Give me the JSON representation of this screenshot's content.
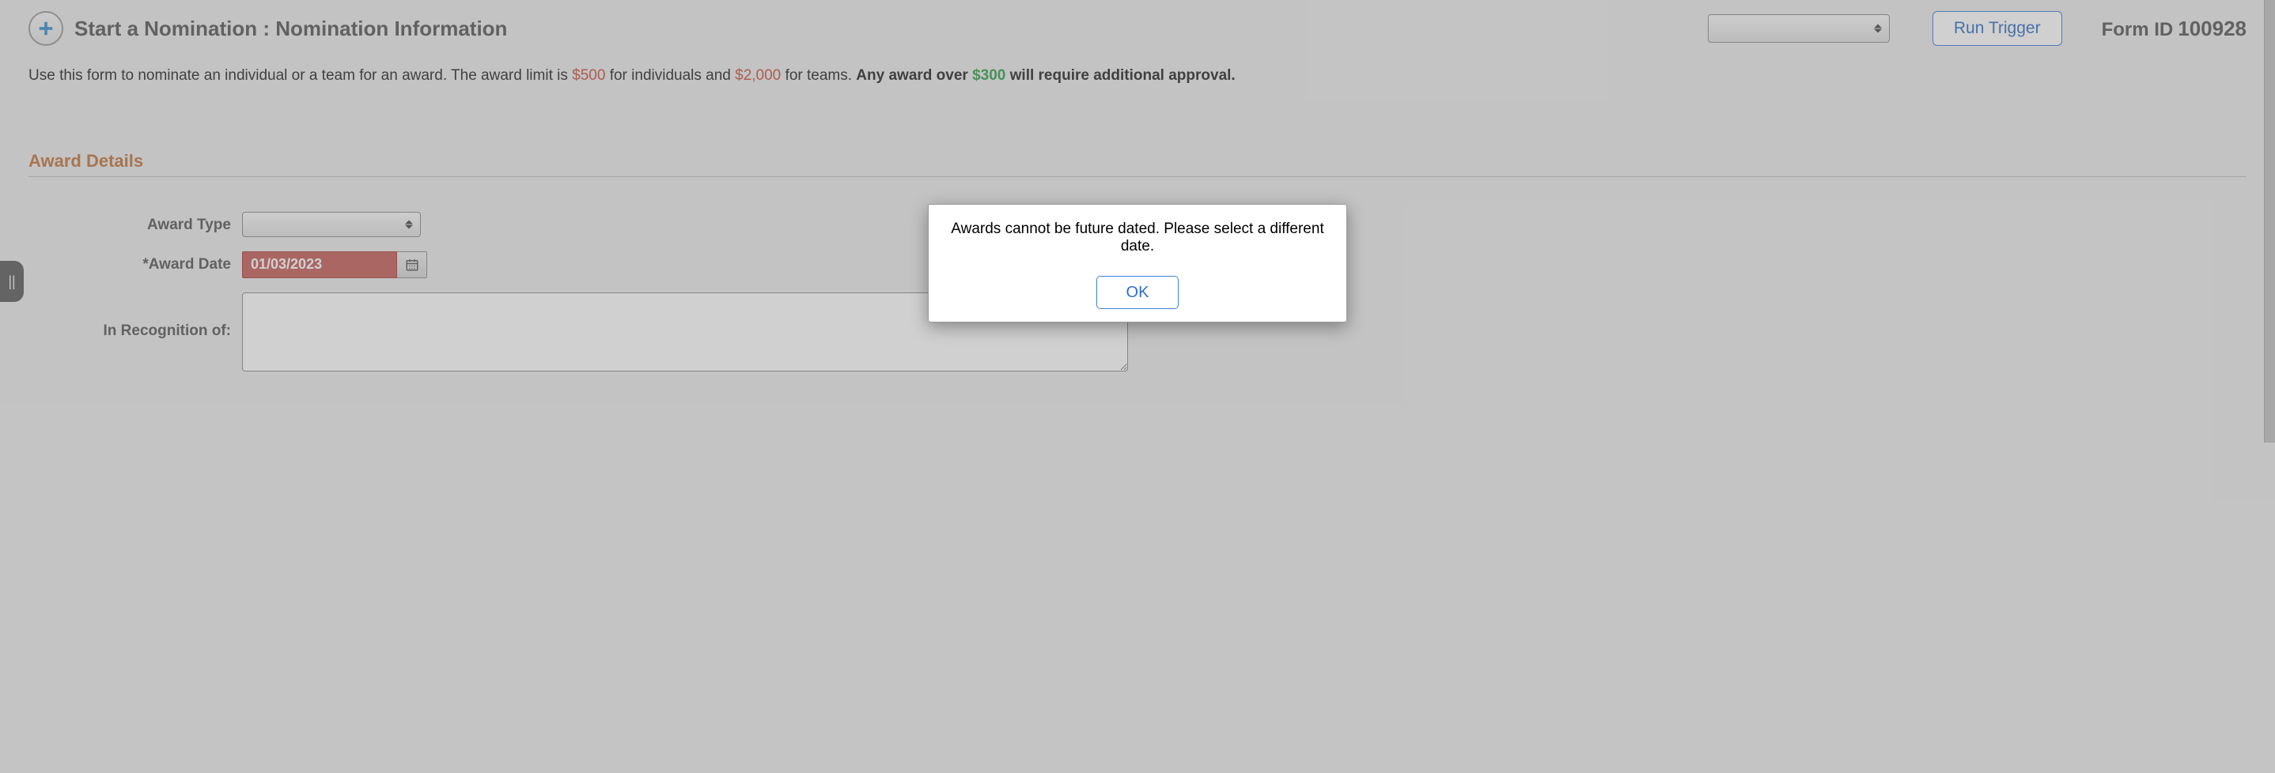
{
  "header": {
    "title": "Start a Nomination :  Nomination Information",
    "run_trigger_label": "Run Trigger",
    "form_id_label": "Form ID",
    "form_id_value": "100928",
    "dropdown_value": ""
  },
  "intro": {
    "prefix": "Use this form to nominate an individual or a team for an award. The award limit is ",
    "amount_individual": "$500",
    "mid1": " for individuals and ",
    "amount_team": "$2,000",
    "mid2": " for teams. ",
    "bold_prefix": "Any award over ",
    "threshold": "$300",
    "bold_suffix": " will require additional approval."
  },
  "section": {
    "title": "Award Details"
  },
  "fields": {
    "award_type_label": "Award Type",
    "award_type_value": "",
    "award_date_label": "*Award Date",
    "award_date_value": "01/03/2023",
    "recognition_label": "In Recognition of:",
    "recognition_value": ""
  },
  "modal": {
    "message": "Awards cannot be future dated. Please select a different date.",
    "ok_label": "OK"
  },
  "side_tab_glyph": "||"
}
